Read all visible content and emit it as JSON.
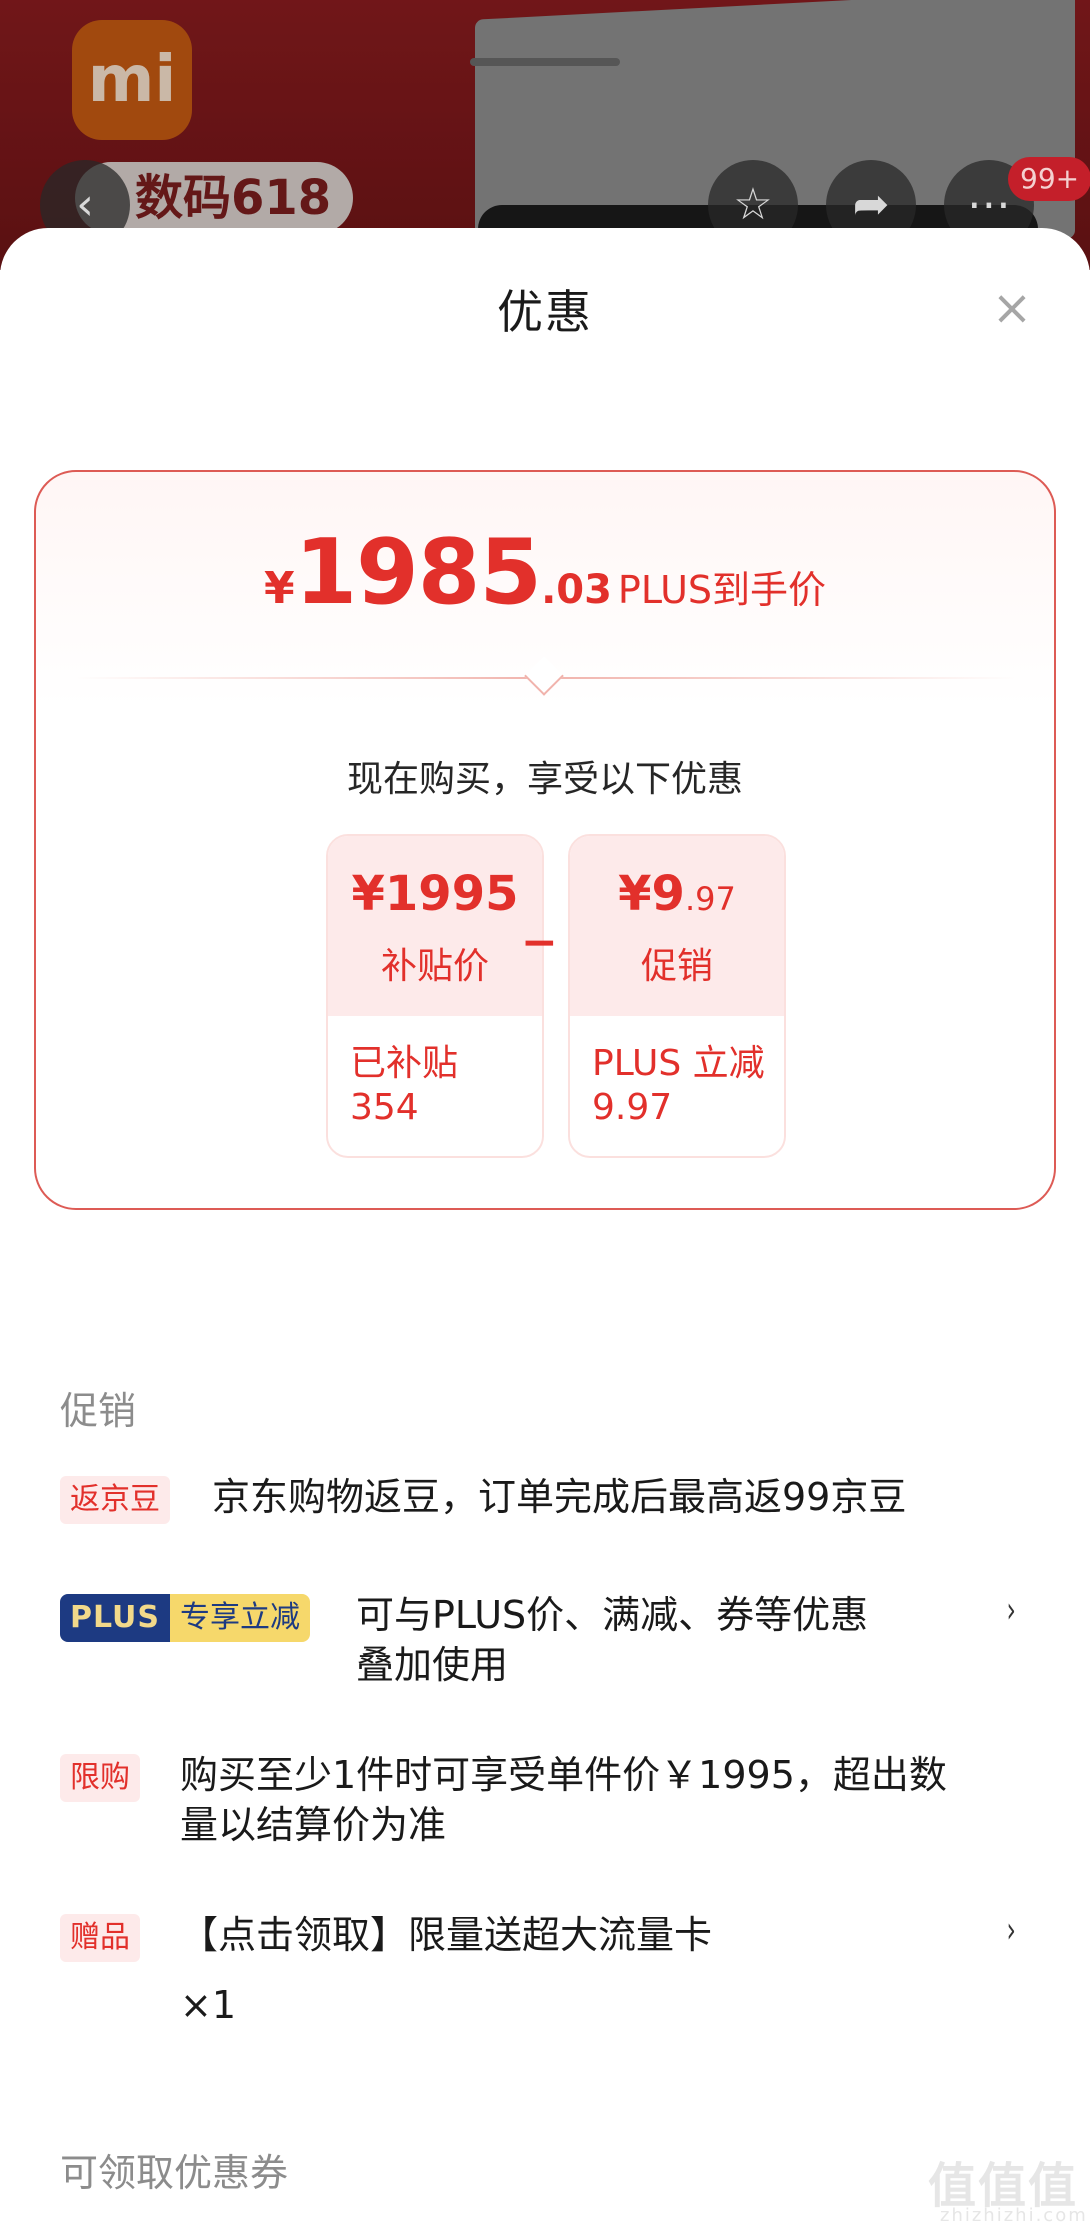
{
  "header": {
    "brand_logo_text": "mi",
    "promo_pill_text": "数码618",
    "back_icon": "chevron-left-icon",
    "favorite_icon": "star-icon",
    "share_icon": "share-icon",
    "more_icon": "more-horizontal-icon",
    "more_badge": "99+"
  },
  "sheet": {
    "title": "优惠",
    "close_icon": "close-icon"
  },
  "price_card": {
    "currency": "¥",
    "price_integer": "1985",
    "price_decimal": ".03",
    "price_label": "PLUS到手价",
    "buy_now_text": "现在购买，享受以下优惠",
    "operator": "−",
    "items": [
      {
        "amount_prefix": "¥",
        "amount": "1995",
        "amount_small": "",
        "name": "补贴价",
        "detail_line1": "已补贴",
        "detail_line2": "354"
      },
      {
        "amount_prefix": "¥",
        "amount": "9",
        "amount_small": ".97",
        "name": "促销",
        "detail_line1": "PLUS 立减",
        "detail_line2": "9.97"
      }
    ]
  },
  "promotions": {
    "section_title": "促销",
    "rows": [
      {
        "tag": "返京豆",
        "text": "京东购物返豆，订单完成后最高返99京豆"
      },
      {
        "tag_left": "PLUS",
        "tag_right": "专享立减",
        "text_line1": "可与PLUS价、满减、券等优惠",
        "text_line2": "叠加使用",
        "chevron": "›"
      },
      {
        "tag": "限购",
        "text_line1": "购买至少1件时可享受单件价￥1995，超出数",
        "text_line2": "量以结算价为准"
      },
      {
        "tag": "赠品",
        "text_line1": "【点击领取】限量送超大流量卡",
        "text_line2": "×1",
        "chevron": "›"
      }
    ]
  },
  "coupons": {
    "section_title": "可领取优惠券"
  },
  "watermark": {
    "text": "值值值",
    "sub": "zhizhizhi.com"
  },
  "colors": {
    "accent": "#e2302b",
    "tag_bg": "#fdeaea",
    "plus_navy": "#1d3a82",
    "plus_gold": "#f6d86b"
  }
}
